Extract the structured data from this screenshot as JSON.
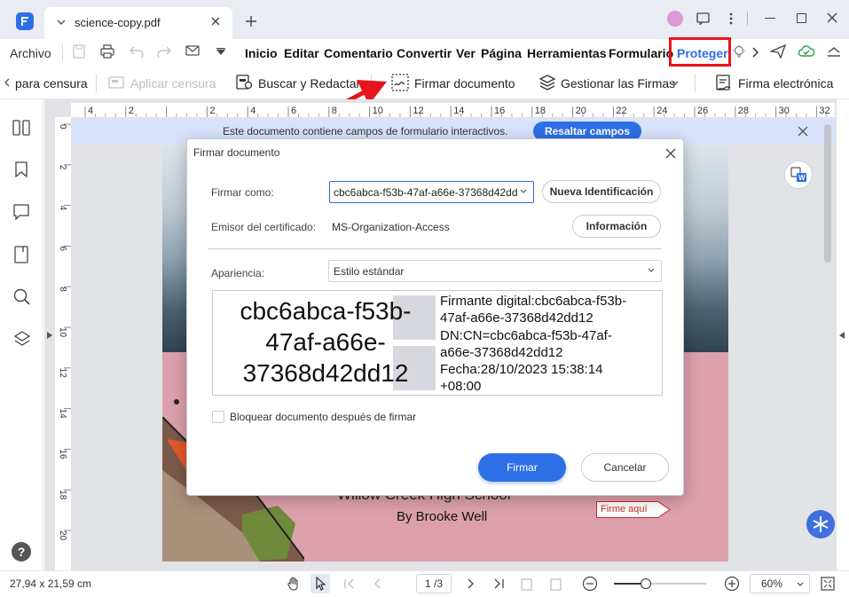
{
  "window": {
    "tab_title": "science-copy.pdf"
  },
  "menubar": {
    "file": "Archivo",
    "items": [
      "Inicio",
      "Editar",
      "Comentario",
      "Convertir",
      "Ver",
      "Página",
      "Herramientas",
      "Formulario"
    ],
    "active": "Proteger"
  },
  "toolbar": {
    "censura": "para censura",
    "aplicar_censura": "Aplicar censura",
    "buscar_redactar": "Buscar y Redactar",
    "firmar_documento": "Firmar documento",
    "gestionar_firmas": "Gestionar las Firmas",
    "firma_electronica": "Firma electrónica"
  },
  "ruler": {
    "top_ticks": [
      "4",
      "2",
      "",
      "2",
      "4",
      "6",
      "8",
      "10",
      "12",
      "14",
      "16",
      "18",
      "20",
      "22",
      "24",
      "26",
      "28",
      "30",
      "32"
    ],
    "left_ticks": [
      "0",
      "2",
      "4",
      "6",
      "8",
      "10",
      "12",
      "14",
      "16",
      "18",
      "20"
    ]
  },
  "form_notice": {
    "text": "Este documento contiene campos de formulario interactivos.",
    "button": "Resaltar campos"
  },
  "document": {
    "school": "Willow Creek High School",
    "author": "By Brooke Well",
    "sign_here": "Firme aquí"
  },
  "dialog": {
    "title": "Firmar documento",
    "sign_as_label": "Firmar como:",
    "sign_as_value": "cbc6abca-f53b-47af-a66e-37368d42dd",
    "new_id_button": "Nueva Identificación",
    "issuer_label": "Emisor del certificado:",
    "issuer_value": "MS-Organization-Access",
    "info_button": "Información",
    "appearance_label": "Apariencia:",
    "appearance_value": "Estilo estándar",
    "preview": {
      "name_lines": [
        "cbc6abca-f53b-",
        "47af-a66e-",
        "37368d42dd12"
      ],
      "detail_lines": [
        "Firmante digital:cbc6abca-f53b-",
        "47af-a66e-37368d42dd12",
        "DN:CN=cbc6abca-f53b-47af-",
        "a66e-37368d42dd12",
        "Fecha:28/10/2023 15:38:14",
        "+08:00"
      ]
    },
    "lock_checkbox_label": "Bloquear documento después de firmar",
    "lock_checked": false,
    "sign_button": "Firmar",
    "cancel_button": "Cancelar"
  },
  "statusbar": {
    "page_size": "27,94 x 21,59 cm",
    "page_indicator": "1 /3",
    "zoom_value": "60%",
    "zoom_fraction": 0.35
  },
  "colors": {
    "accent": "#2d6fe6",
    "annotation_red": "#e8141c"
  }
}
